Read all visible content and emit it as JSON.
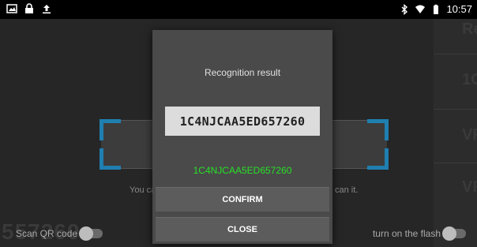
{
  "status_bar": {
    "left_icons": [
      "image-icon",
      "lock-icon",
      "upload-icon"
    ],
    "right_icons": [
      "bluetooth-icon",
      "wifi-icon",
      "battery-icon"
    ],
    "time": "10:57"
  },
  "scanner": {
    "hint_left": "You ca",
    "hint_right": "can it.",
    "bg_number": "557260",
    "right_panel": [
      "Re",
      "1C",
      "VF",
      "VF"
    ]
  },
  "bottom": {
    "scan_qr_label": "Scan QR code",
    "flash_label": "turn on the flash"
  },
  "dialog": {
    "title": "Recognition result",
    "vin_image_text": "1C4NJCAA5ED657260",
    "vin_result": "1C4NJCAA5ED657260",
    "confirm_label": "CONFIRM",
    "close_label": "CLOSE"
  },
  "colors": {
    "accent_green": "#27e027",
    "frame_blue": "#1f7fb0"
  }
}
